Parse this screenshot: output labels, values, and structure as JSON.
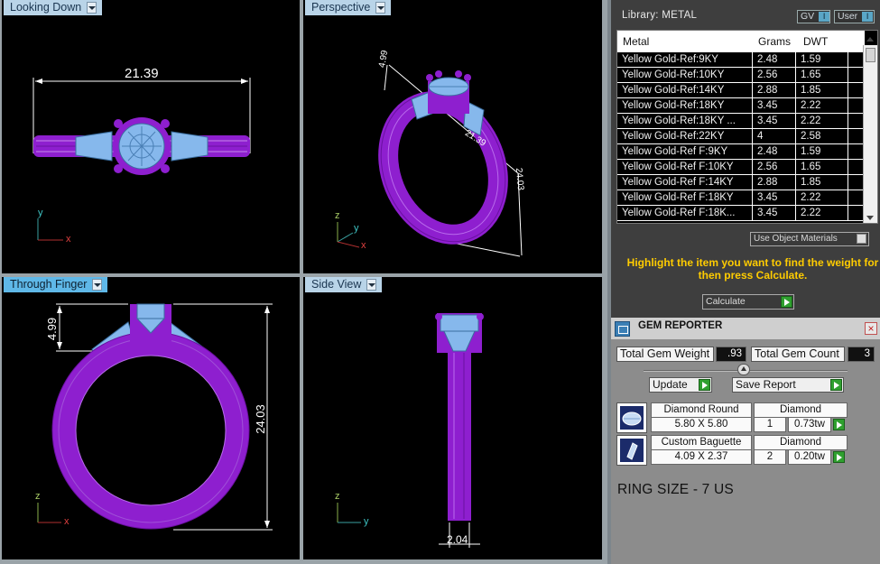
{
  "viewports": {
    "top_left": {
      "label": "Looking Down",
      "dimension": "21.39",
      "axis1": "y",
      "axis2": "x"
    },
    "top_right": {
      "label": "Perspective",
      "dim_height": "4.99",
      "dim_width": "21.39",
      "dim_diameter": "24.03",
      "axis1": "z",
      "axis2": "y",
      "axis3": "x"
    },
    "bottom_left": {
      "label": "Through Finger",
      "dim_height": "4.99",
      "dim_diameter": "24.03",
      "axis1": "z",
      "axis2": "x"
    },
    "bottom_right": {
      "label": "Side View",
      "dimension": "2.04",
      "axis1": "z",
      "axis2": "y"
    }
  },
  "library": {
    "title": "Library: METAL",
    "gv_label": "GV",
    "user_label": "User",
    "columns": [
      "Metal",
      "Grams",
      "DWT"
    ],
    "rows": [
      [
        "Yellow Gold-Ref:9KY",
        "2.48",
        "1.59"
      ],
      [
        "Yellow Gold-Ref:10KY",
        "2.56",
        "1.65"
      ],
      [
        "Yellow Gold-Ref:14KY",
        "2.88",
        "1.85"
      ],
      [
        "Yellow Gold-Ref:18KY",
        "3.45",
        "2.22"
      ],
      [
        "Yellow Gold-Ref:18KY ...",
        "3.45",
        "2.22"
      ],
      [
        "Yellow Gold-Ref:22KY",
        "4",
        "2.58"
      ],
      [
        "Yellow Gold-Ref F:9KY",
        "2.48",
        "1.59"
      ],
      [
        "Yellow Gold-Ref F:10KY",
        "2.56",
        "1.65"
      ],
      [
        "Yellow Gold-Ref F:14KY",
        "2.88",
        "1.85"
      ],
      [
        "Yellow Gold-Ref F:18KY",
        "3.45",
        "2.22"
      ],
      [
        "Yellow Gold-Ref F:18K...",
        "3.45",
        "2.22"
      ]
    ],
    "use_object_materials": "Use Object Materials",
    "hint": "Highlight the item you want to find the weight for then press Calculate.",
    "calculate_label": "Calculate"
  },
  "gem_reporter": {
    "title": "GEM REPORTER",
    "total_weight_label": "Total Gem Weight",
    "total_weight_value": ".93",
    "total_count_label": "Total Gem Count",
    "total_count_value": "3",
    "update_label": "Update",
    "save_report_label": "Save Report",
    "gems": [
      {
        "shape": "Diamond Round",
        "material": "Diamond",
        "size": "5.80 X 5.80",
        "count": "1",
        "weight": "0.73tw"
      },
      {
        "shape": "Custom Baguette",
        "material": "Diamond",
        "size": "4.09 X 2.37",
        "count": "2",
        "weight": "0.20tw"
      }
    ],
    "ring_size": "RING SIZE - 7 US"
  },
  "colors": {
    "ring_metal": "#8e1fcf",
    "gem": "#86b8ec",
    "active_tab": "#5fb8e8",
    "hint_text": "#ffcc00"
  }
}
